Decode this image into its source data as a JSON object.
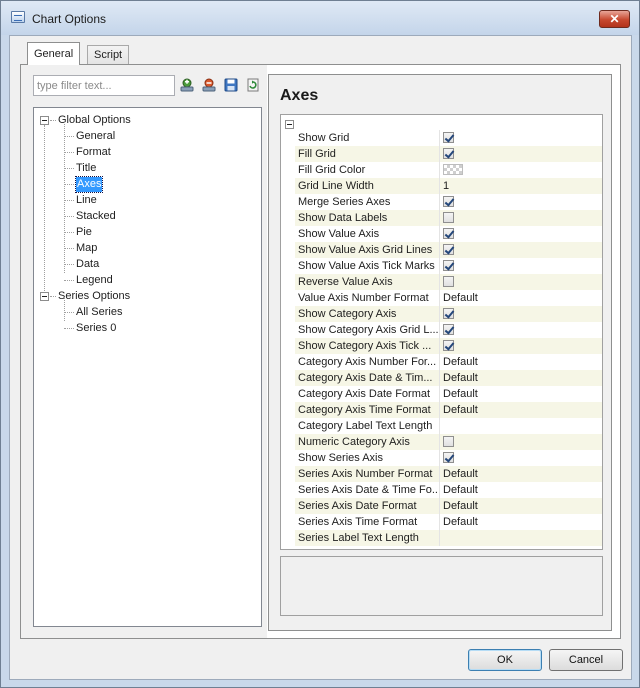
{
  "window": {
    "title": "Chart Options",
    "close_symbol": "✕"
  },
  "tabs": [
    {
      "label": "General",
      "active": true
    },
    {
      "label": "Script",
      "active": false
    }
  ],
  "filter": {
    "placeholder": "type filter text...",
    "value": ""
  },
  "toolbar_icons": [
    "add-icon",
    "remove-icon",
    "save-icon",
    "refresh-icon"
  ],
  "tree": {
    "global": {
      "label": "Global Options",
      "children": [
        "General",
        "Format",
        "Title",
        "Axes",
        "Line",
        "Stacked",
        "Pie",
        "Map",
        "Data",
        "Legend"
      ]
    },
    "series": {
      "label": "Series Options",
      "children": [
        "All Series",
        "Series 0"
      ]
    },
    "selected": "Axes"
  },
  "section": {
    "title": "Axes"
  },
  "properties": [
    {
      "name": "Show Grid",
      "type": "checkbox",
      "checked": true
    },
    {
      "name": "Fill Grid",
      "type": "checkbox",
      "checked": true
    },
    {
      "name": "Fill Grid Color",
      "type": "color",
      "value": ""
    },
    {
      "name": "Grid Line Width",
      "type": "text",
      "value": "1"
    },
    {
      "name": "Merge Series Axes",
      "type": "checkbox",
      "checked": true
    },
    {
      "name": "Show Data Labels",
      "type": "checkbox",
      "checked": false
    },
    {
      "name": "Show Value Axis",
      "type": "checkbox",
      "checked": true
    },
    {
      "name": "Show Value Axis Grid Lines",
      "type": "checkbox",
      "checked": true
    },
    {
      "name": "Show Value Axis Tick Marks",
      "type": "checkbox",
      "checked": true
    },
    {
      "name": "Reverse Value Axis",
      "type": "checkbox",
      "checked": false
    },
    {
      "name": "Value Axis Number Format",
      "type": "text",
      "value": "Default"
    },
    {
      "name": "Show Category Axis",
      "type": "checkbox",
      "checked": true
    },
    {
      "name": "Show Category Axis Grid L...",
      "type": "checkbox",
      "checked": true
    },
    {
      "name": "Show Category Axis Tick ...",
      "type": "checkbox",
      "checked": true
    },
    {
      "name": "Category Axis Number For...",
      "type": "text",
      "value": "Default"
    },
    {
      "name": "Category Axis Date & Tim...",
      "type": "text",
      "value": "Default"
    },
    {
      "name": "Category Axis Date Format",
      "type": "text",
      "value": "Default"
    },
    {
      "name": "Category Axis Time Format",
      "type": "text",
      "value": "Default"
    },
    {
      "name": "Category Label Text Length",
      "type": "text",
      "value": ""
    },
    {
      "name": "Numeric Category Axis",
      "type": "checkbox",
      "checked": false
    },
    {
      "name": "Show Series Axis",
      "type": "checkbox",
      "checked": true
    },
    {
      "name": "Series Axis Number Format",
      "type": "text",
      "value": "Default"
    },
    {
      "name": "Series Axis Date & Time Fo...",
      "type": "text",
      "value": "Default"
    },
    {
      "name": "Series Axis Date Format",
      "type": "text",
      "value": "Default"
    },
    {
      "name": "Series Axis Time Format",
      "type": "text",
      "value": "Default"
    },
    {
      "name": "Series Label Text Length",
      "type": "text",
      "value": ""
    }
  ],
  "buttons": {
    "ok": "OK",
    "cancel": "Cancel"
  }
}
